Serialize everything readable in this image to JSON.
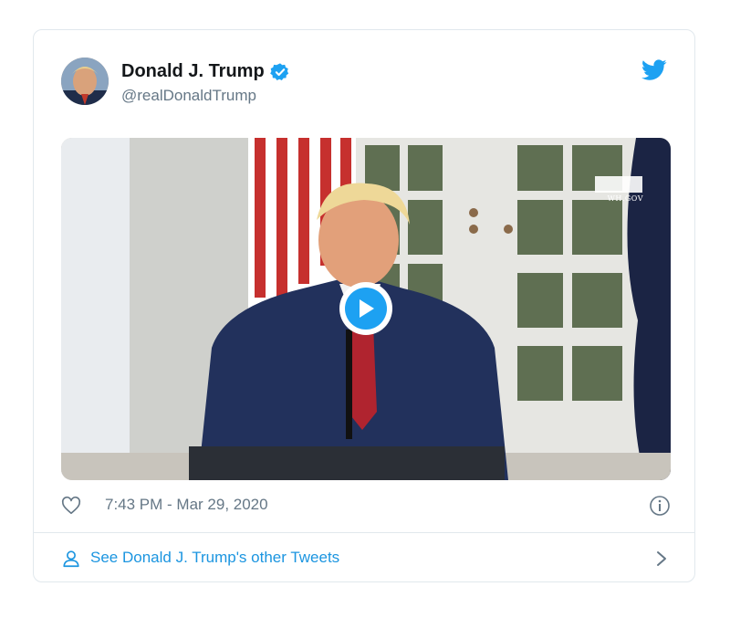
{
  "tweet": {
    "author_name": "Donald J. Trump",
    "handle": "@realDonaldTrump",
    "timestamp": "7:43 PM - Mar 29, 2020",
    "media": {
      "watermark": "WH.GOV"
    }
  },
  "footer": {
    "link_text": "See Donald J. Trump's other Tweets"
  },
  "icons": {
    "brand": "twitter-bird-icon",
    "verified": "verified-badge-icon",
    "like": "heart-icon",
    "info": "info-icon",
    "profile": "person-icon",
    "more": "chevron-right-icon",
    "play": "play-icon"
  },
  "colors": {
    "brand_blue": "#1da1f2",
    "link_blue": "#1b95e0",
    "name_text": "#14171a",
    "muted_text": "#657786",
    "border": "#e1e8ed"
  }
}
